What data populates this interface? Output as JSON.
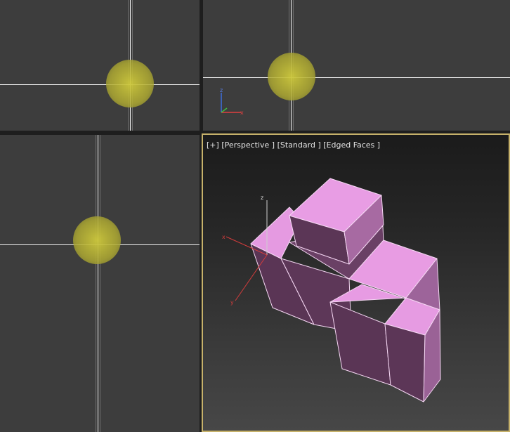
{
  "perspective_label": {
    "plus": "[+]",
    "view": "[Perspective ]",
    "shading": "[Standard ]",
    "display": "[Edged Faces ]"
  },
  "axis_labels": {
    "x": "x",
    "y": "y",
    "z": "z"
  },
  "colors": {
    "viewport_bg": "#3d3d3d",
    "active_border": "#c6b16a",
    "object_face": "#e79be3",
    "object_shadow": "#5b3656",
    "grid_axis": "#f2f2f2",
    "pivot_glow": "#c8c83c"
  }
}
